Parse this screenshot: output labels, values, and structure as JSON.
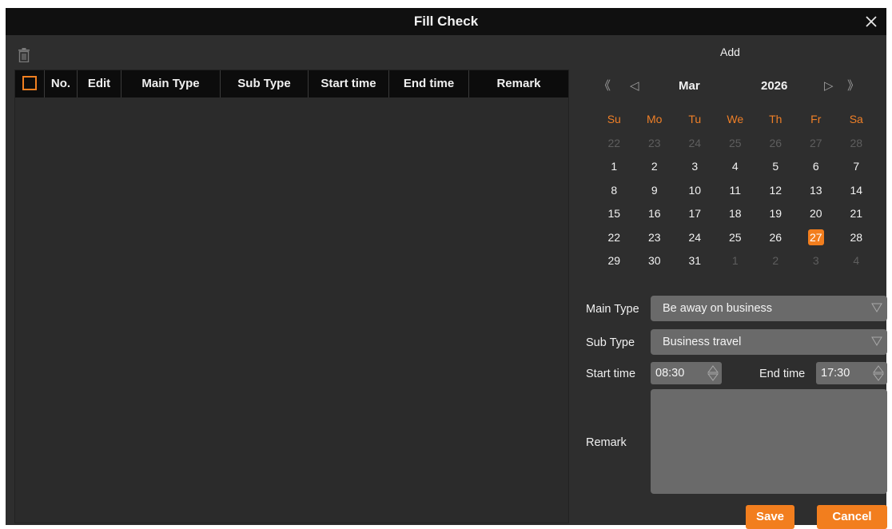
{
  "window": {
    "title": "Fill Check"
  },
  "table": {
    "columns": [
      "No.",
      "Edit",
      "Main Type",
      "Sub Type",
      "Start time",
      "End time",
      "Remark"
    ],
    "rows": []
  },
  "panel": {
    "title": "Add"
  },
  "calendar": {
    "month": "Mar",
    "year": "2026",
    "nav": {
      "prev_year": "《",
      "prev_month": "◁",
      "next_month": "▷",
      "next_year": "》"
    },
    "weekdays": [
      "Su",
      "Mo",
      "Tu",
      "We",
      "Th",
      "Fr",
      "Sa"
    ],
    "weeks": [
      [
        [
          "22",
          "other"
        ],
        [
          "23",
          "other"
        ],
        [
          "24",
          "other"
        ],
        [
          "25",
          "other"
        ],
        [
          "26",
          "other"
        ],
        [
          "27",
          "other"
        ],
        [
          "28",
          "other"
        ]
      ],
      [
        [
          "1",
          "cur"
        ],
        [
          "2",
          "cur"
        ],
        [
          "3",
          "cur"
        ],
        [
          "4",
          "cur"
        ],
        [
          "5",
          "cur"
        ],
        [
          "6",
          "cur"
        ],
        [
          "7",
          "cur"
        ]
      ],
      [
        [
          "8",
          "cur"
        ],
        [
          "9",
          "cur"
        ],
        [
          "10",
          "cur"
        ],
        [
          "11",
          "cur"
        ],
        [
          "12",
          "cur"
        ],
        [
          "13",
          "cur"
        ],
        [
          "14",
          "cur"
        ]
      ],
      [
        [
          "15",
          "cur"
        ],
        [
          "16",
          "cur"
        ],
        [
          "17",
          "cur"
        ],
        [
          "18",
          "cur"
        ],
        [
          "19",
          "cur"
        ],
        [
          "20",
          "cur"
        ],
        [
          "21",
          "cur"
        ]
      ],
      [
        [
          "22",
          "cur"
        ],
        [
          "23",
          "cur"
        ],
        [
          "24",
          "cur"
        ],
        [
          "25",
          "cur"
        ],
        [
          "26",
          "cur"
        ],
        [
          "27",
          "sel"
        ],
        [
          "28",
          "cur"
        ]
      ],
      [
        [
          "29",
          "cur"
        ],
        [
          "30",
          "cur"
        ],
        [
          "31",
          "cur"
        ],
        [
          "1",
          "other"
        ],
        [
          "2",
          "other"
        ],
        [
          "3",
          "other"
        ],
        [
          "4",
          "other"
        ]
      ]
    ]
  },
  "form": {
    "main_type_label": "Main Type",
    "main_type_value": "Be away on business",
    "sub_type_label": "Sub Type",
    "sub_type_value": "Business travel",
    "start_time_label": "Start time",
    "start_time_value": "08:30",
    "end_time_label": "End time",
    "end_time_value": "17:30",
    "remark_label": "Remark",
    "remark_value": ""
  },
  "buttons": {
    "save": "Save",
    "cancel": "Cancel"
  },
  "colors": {
    "accent": "#f27e1e",
    "titlebar": "#101010",
    "background": "#2e2e2e",
    "field": "#6a6a6a"
  }
}
